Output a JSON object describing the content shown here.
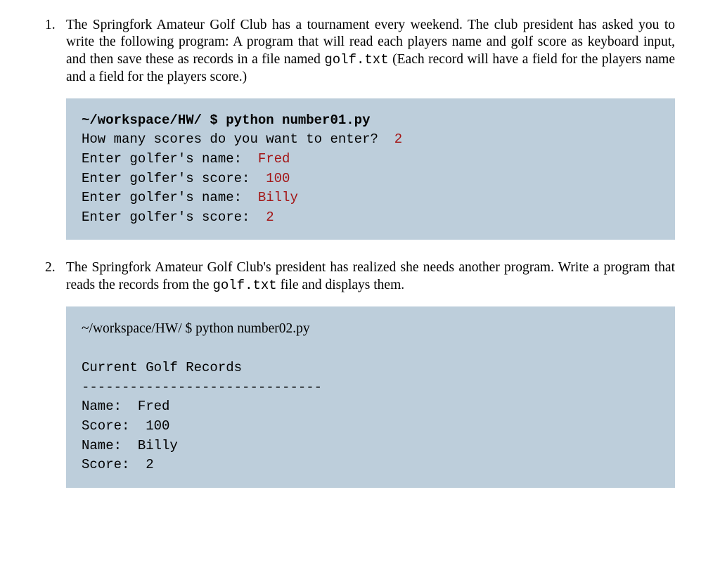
{
  "item1": {
    "number": "1.",
    "text_pre": "The Springfork Amateur Golf Club has a tournament every weekend. The club president has asked you to write the following program:\nA program that will read each players name and golf score as keyboard input, and then save these as records in a file named ",
    "code_token": "golf.txt",
    "text_post": " (Each record will have a field for the players name and a field for the players score.)"
  },
  "code1": {
    "prompt_path": "~/workspace/HW/ $ ",
    "prompt_cmd": "python number01.py",
    "l1_a": "How many scores do you want to enter?  ",
    "l1_b": "2",
    "l2_a": "Enter golfer's name:  ",
    "l2_b": "Fred",
    "l3_a": "Enter golfer's score:  ",
    "l3_b": "100",
    "l4_a": "Enter golfer's name:  ",
    "l4_b": "Billy",
    "l5_a": "Enter golfer's score:  ",
    "l5_b": "2"
  },
  "item2": {
    "number": "2.",
    "text_pre": "The Springfork Amateur Golf Club's president has realized she needs another program. Write a program that reads the records from the ",
    "code_token": "golf.txt",
    "text_post": " file and displays them."
  },
  "code2": {
    "prompt_path": "~/workspace/HW/ $ ",
    "prompt_cmd": "python number02.py",
    "blank": "",
    "hdr": "Current Golf Records",
    "rule": "------------------------------",
    "n1": "Name:  Fred",
    "s1": "Score:  100",
    "n2": "Name:  Billy",
    "s2": "Score:  2"
  }
}
